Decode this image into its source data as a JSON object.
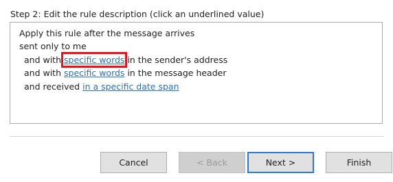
{
  "step": {
    "label": "Step 2: Edit the rule description (click an underlined value)"
  },
  "rule": {
    "line1": "Apply this rule after the message arrives",
    "line2": "sent only to me",
    "line3_prefix": "and with",
    "line3_link": "specific words",
    "line3_suffix": "in the sender's address",
    "line4_prefix": "and with",
    "line4_link": "specific words",
    "line4_suffix": "in the message header",
    "line5_prefix": "and received",
    "line5_link": "in a specific date span"
  },
  "buttons": {
    "cancel": "Cancel",
    "back": "< Back",
    "next": "Next >",
    "finish": "Finish"
  },
  "colors": {
    "link": "#2a6fbd",
    "highlight": "#e8121a",
    "default_button_border": "#2b78d4"
  }
}
